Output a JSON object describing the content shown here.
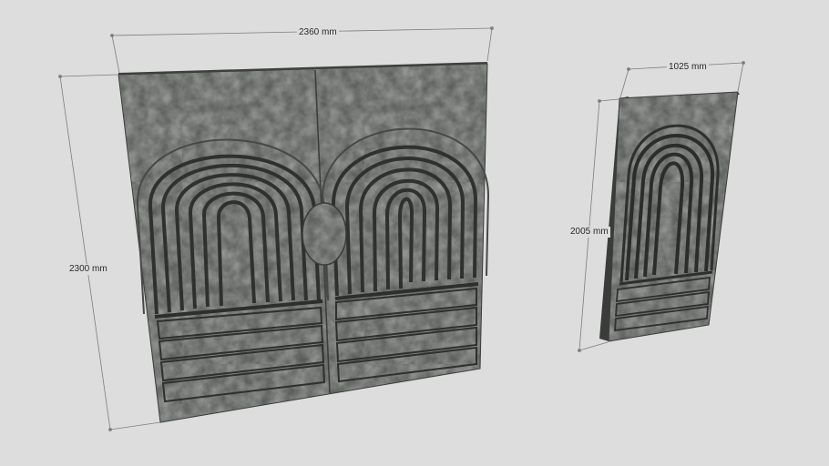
{
  "scene": {
    "background_color": "#dddddd",
    "panel_color": "#5b5e5b",
    "panel_dark": "#3d3f3d",
    "groove_color": "#2b2c2b",
    "dimension_line_color": "#7a7a7a"
  },
  "double_gate": {
    "width_dimension": "2360 mm",
    "height_dimension": "2300 mm"
  },
  "single_gate": {
    "width_dimension": "1025 mm",
    "height_dimension": "2005 mm"
  }
}
